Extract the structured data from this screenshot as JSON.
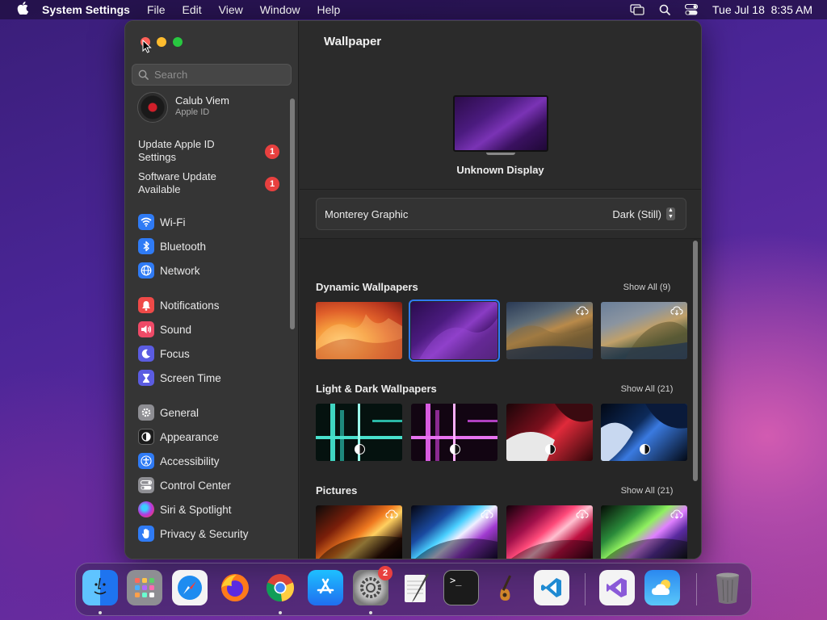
{
  "menubar": {
    "app_name": "System Settings",
    "items": [
      "File",
      "Edit",
      "View",
      "Window",
      "Help"
    ],
    "datetime": "Tue Jul 18  8:35 AM"
  },
  "sidebar": {
    "search_placeholder": "Search",
    "profile": {
      "name": "Calub Viem",
      "subtitle": "Apple ID"
    },
    "alerts": [
      {
        "label": "Update Apple ID Settings",
        "badge": "1"
      },
      {
        "label": "Software Update Available",
        "badge": "1"
      }
    ],
    "groups": [
      [
        {
          "label": "Wi-Fi",
          "icon": "wifi-icon",
          "color": "#2f7bf5"
        },
        {
          "label": "Bluetooth",
          "icon": "bluetooth-icon",
          "color": "#2f7bf5"
        },
        {
          "label": "Network",
          "icon": "globe-icon",
          "color": "#2f7bf5"
        }
      ],
      [
        {
          "label": "Notifications",
          "icon": "bell-icon",
          "color": "#ef4a48"
        },
        {
          "label": "Sound",
          "icon": "speaker-icon",
          "color": "#ef4a67"
        },
        {
          "label": "Focus",
          "icon": "moon-icon",
          "color": "#5b5ce2"
        },
        {
          "label": "Screen Time",
          "icon": "hourglass-icon",
          "color": "#5b5ce2"
        }
      ],
      [
        {
          "label": "General",
          "icon": "gear-icon",
          "color": "#8e8e93"
        },
        {
          "label": "Appearance",
          "icon": "appearance-icon",
          "color": "#1c1c1c"
        },
        {
          "label": "Accessibility",
          "icon": "accessibility-icon",
          "color": "#2f7bf5"
        },
        {
          "label": "Control Center",
          "icon": "control-center-icon",
          "color": "#8e8e93"
        },
        {
          "label": "Siri & Spotlight",
          "icon": "siri-icon",
          "color": "#7d3ad9"
        },
        {
          "label": "Privacy & Security",
          "icon": "hand-icon",
          "color": "#2f7bf5"
        }
      ]
    ]
  },
  "content": {
    "title": "Wallpaper",
    "display_name": "Unknown Display",
    "current_wallpaper": "Monterey Graphic",
    "appearance_mode": "Dark (Still)",
    "sections": [
      {
        "title": "Dynamic Wallpapers",
        "show_all": "Show All (9)"
      },
      {
        "title": "Light & Dark Wallpapers",
        "show_all": "Show All (21)"
      },
      {
        "title": "Pictures",
        "show_all": "Show All (21)"
      }
    ]
  },
  "dock": {
    "apps": [
      {
        "name": "Finder",
        "icon": "finder-icon"
      },
      {
        "name": "Launchpad",
        "icon": "launchpad-icon"
      },
      {
        "name": "Safari",
        "icon": "safari-icon"
      },
      {
        "name": "Firefox",
        "icon": "firefox-icon"
      },
      {
        "name": "Chrome",
        "icon": "chrome-icon"
      },
      {
        "name": "App Store",
        "icon": "app-store-icon"
      },
      {
        "name": "System Settings",
        "icon": "system-settings-icon",
        "badge": "2"
      },
      {
        "name": "TextEdit",
        "icon": "textedit-icon"
      },
      {
        "name": "Terminal",
        "icon": "terminal-icon"
      },
      {
        "name": "GarageBand",
        "icon": "garageband-icon"
      },
      {
        "name": "Visual Studio Code",
        "icon": "vscode-icon"
      },
      {
        "name": "Visual Studio",
        "icon": "visual-studio-icon"
      },
      {
        "name": "Weather",
        "icon": "weather-icon"
      },
      {
        "name": "Trash",
        "icon": "trash-icon"
      }
    ]
  }
}
